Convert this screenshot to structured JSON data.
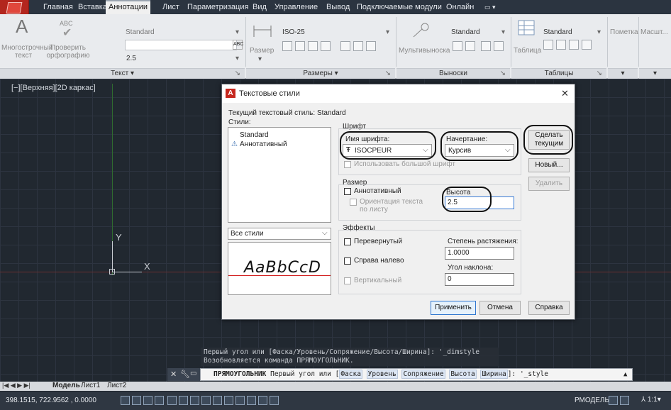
{
  "ribbon_tabs": [
    "Главная",
    "Вставка",
    "Аннотации",
    "Лист",
    "Параметризация",
    "Вид",
    "Управление",
    "Вывод",
    "Подключаемые модули",
    "Онлайн"
  ],
  "active_tab": "Аннотации",
  "ribbon": {
    "text_panel": {
      "mtext_label": "Многострочный\nтекст",
      "spell_abc": "ABC",
      "spell_label": "Проверить\nорфографию",
      "style_combo": "Standard",
      "height_combo": "2.5",
      "footer": "Текст ▾"
    },
    "dims_panel": {
      "dim_button": "Размер",
      "style_combo": "ISO-25",
      "footer": "Размеры ▾"
    },
    "leaders_panel": {
      "mleader_button": "Мультивыноска",
      "style_combo": "Standard",
      "footer": "Выноски"
    },
    "tables_panel": {
      "table_button": "Таблица",
      "style_combo": "Standard",
      "footer": "Таблицы"
    },
    "markup_label": "Пометка",
    "scale_label": "Масшт..."
  },
  "viewport_label": "[−][Верхняя][2D каркас]",
  "axes": {
    "y": "Y",
    "x": "X"
  },
  "dialog": {
    "title": "Текстовые стили",
    "close": "✕",
    "current_style_label": "Текущий текстовый стиль:  Standard",
    "styles_label": "Стили:",
    "styles": [
      "Standard",
      "Аннотативный"
    ],
    "filter_combo": "Все стили",
    "preview_text": "AaBbCcD",
    "font_group": "Шрифт",
    "font_name_label": "Имя шрифта:",
    "font_name": "ISOCPEUR",
    "font_style_label": "Начертание:",
    "font_style": "Курсив",
    "bigfont_label": "Использовать большой шрифт",
    "size_group": "Размер",
    "annotative_label": "Аннотативный",
    "match_orient_label": "Ориентация текста\nпо листу",
    "height_label": "Высота",
    "height_value": "2.5",
    "effects_group": "Эффекты",
    "upside_down": "Перевернутый",
    "backwards": "Справа налево",
    "vertical": "Вертикальный",
    "width_factor_label": "Степень растяжения:",
    "width_factor": "1.0000",
    "oblique_label": "Угол наклона:",
    "oblique": "0",
    "set_current": "Сделать\nтекущим",
    "new": "Новый...",
    "delete": "Удалить",
    "apply": "Применить",
    "cancel": "Отмена",
    "help": "Справка"
  },
  "command": {
    "history1": "Первый угол или [Фаска/Уровень/Сопряжение/Высота/Ширина]: '_dimstyle",
    "history2": "Возобновляется команда ПРЯМОУГОЛЬНИК.",
    "prompt_cmd": "ПРЯМОУГОЛЬНИК",
    "prompt_text": "Первый угол или [",
    "options": [
      "Фаска",
      "Уровень",
      "Сопряжение",
      "Высота",
      "Ширина"
    ],
    "prompt_tail": "]: '_style"
  },
  "layout_tabs": [
    "Модель",
    "Лист1",
    "Лист2"
  ],
  "status": {
    "coords": "398.1515, 722.9562 , 0.0000",
    "model_label": "РМОДЕЛЬ",
    "scale": "1:1"
  }
}
